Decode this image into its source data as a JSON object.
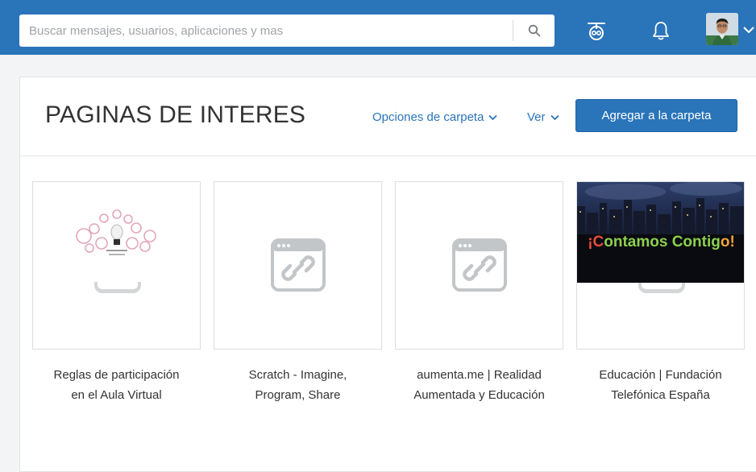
{
  "header": {
    "search": {
      "placeholder": "Buscar mensajes, usuarios, aplicaciones y mas",
      "value": ""
    },
    "icons": [
      "search-icon",
      "apps-icon",
      "bell-icon",
      "chevron-down-icon"
    ],
    "colors": {
      "bar": "#2a74b9"
    }
  },
  "folder": {
    "title": "PAGINAS DE INTERES",
    "options_label": "Opciones de carpeta",
    "view_label": "Ver",
    "add_button_label": "Agregar a la carpeta"
  },
  "items": [
    {
      "caption_line1": "Reglas de participación",
      "caption_line2": "en el Aula Virtual",
      "thumbnail": "mind-map"
    },
    {
      "caption_line1": "Scratch - Imagine,",
      "caption_line2": "Program, Share",
      "thumbnail": "link-icon"
    },
    {
      "caption_line1": "aumenta.me | Realidad",
      "caption_line2": "Aumentada y Educación",
      "thumbnail": "link-icon"
    },
    {
      "caption_line1": "Educación | Fundación",
      "caption_line2": "Telefónica España",
      "thumbnail": "banner",
      "banner_text": {
        "part1": "¡C",
        "part2": "ontamos Contig",
        "part3": "o!"
      }
    }
  ]
}
